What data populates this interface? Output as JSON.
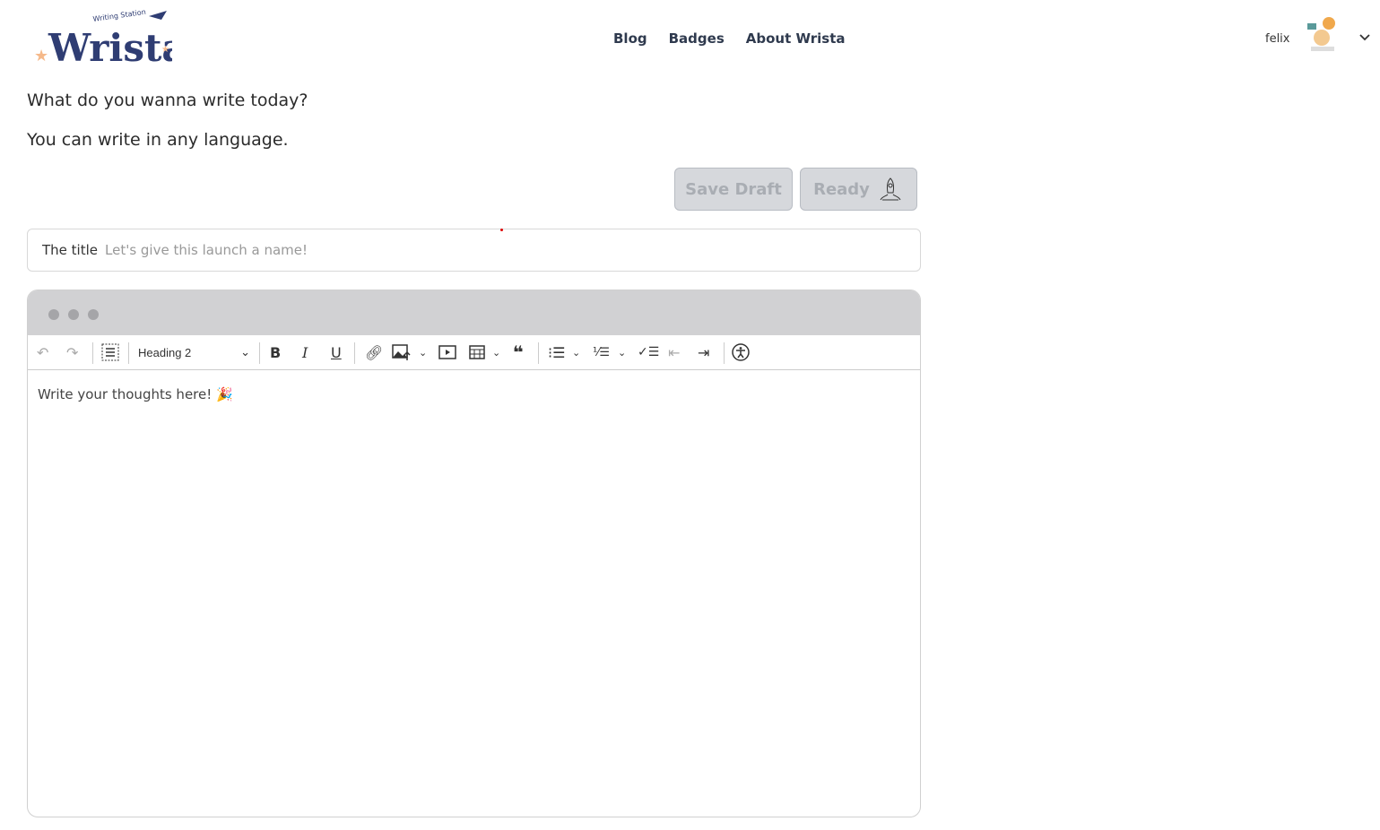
{
  "brand": {
    "logo_text": "Wrista",
    "logo_subtitle": "Writing Station"
  },
  "nav": {
    "items": [
      "Blog",
      "Badges",
      "About Wrista"
    ]
  },
  "user": {
    "name": "felix"
  },
  "prompt": {
    "line1": "What do you wanna write today?",
    "line2": "You can write in any language."
  },
  "actions": {
    "save_draft": "Save Draft",
    "ready": "Ready"
  },
  "title_field": {
    "label": "The title",
    "placeholder": "Let's give this launch a name!"
  },
  "editor": {
    "heading_select": "Heading 2",
    "placeholder": "Write your thoughts here! 🎉"
  },
  "colors": {
    "brand": "#2f3d73",
    "accent": "#f5b98a",
    "disabled_button": "#d6d8dc"
  }
}
